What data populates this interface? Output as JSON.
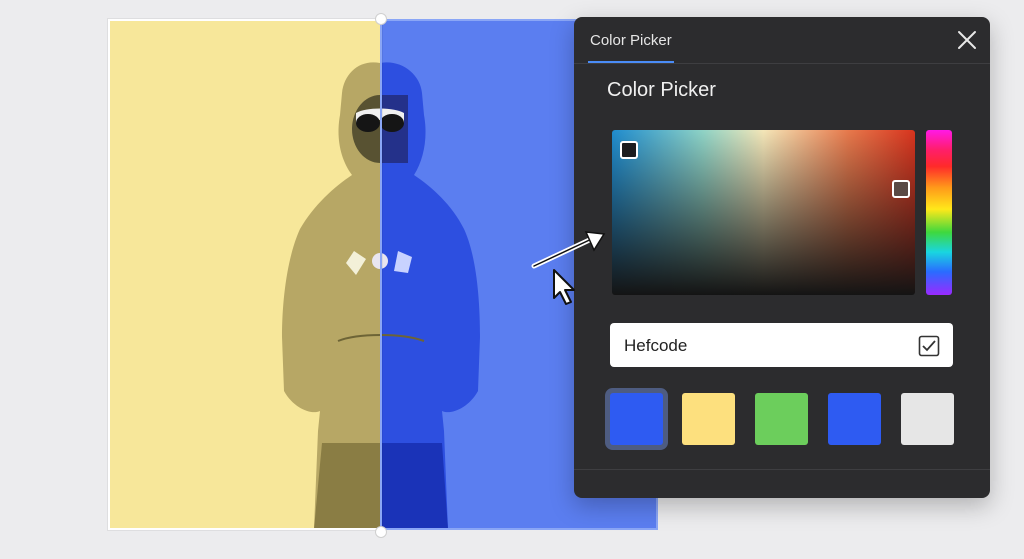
{
  "panel": {
    "tab_label": "Color Picker",
    "title": "Color Picker",
    "close_icon": "close-icon",
    "hex_input": {
      "value": "Hefcode"
    },
    "confirm_icon": "checkbox-icon",
    "swatches": [
      "#2e5bf2",
      "#fde07e",
      "#6cce5c",
      "#2e5bf2",
      "#e6e6e6"
    ],
    "selected_swatch": 0,
    "accent_color": "#4a8cf7"
  },
  "canvas": {
    "left_color": "#f7e79a",
    "right_color": "#5b7ef0"
  }
}
